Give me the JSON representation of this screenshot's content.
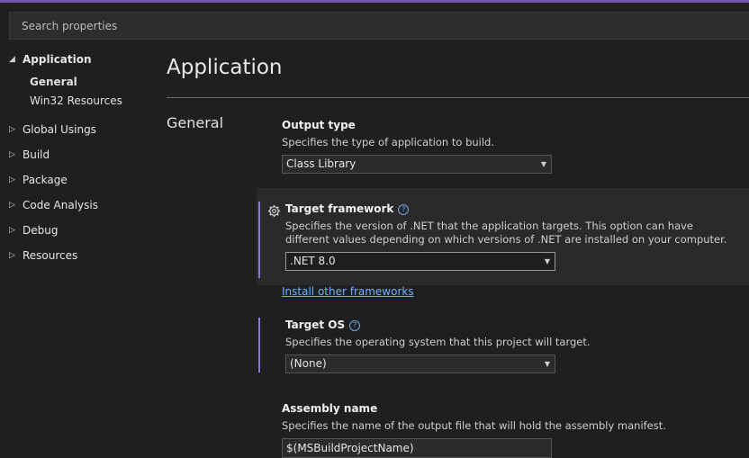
{
  "search": {
    "placeholder": "Search properties"
  },
  "sidebar": {
    "groups": [
      {
        "label": "Application",
        "expanded": true,
        "children": [
          "General",
          "Win32 Resources"
        ]
      },
      {
        "label": "Global Usings"
      },
      {
        "label": "Build"
      },
      {
        "label": "Package"
      },
      {
        "label": "Code Analysis"
      },
      {
        "label": "Debug"
      },
      {
        "label": "Resources"
      }
    ]
  },
  "main": {
    "title": "Application",
    "section": "General",
    "output_type": {
      "label": "Output type",
      "desc": "Specifies the type of application to build.",
      "value": "Class Library"
    },
    "target_framework": {
      "label": "Target framework",
      "desc": "Specifies the version of .NET that the application targets. This option can have different values depending on which versions of .NET are installed on your computer.",
      "value": ".NET 8.0",
      "link": "Install other frameworks"
    },
    "target_os": {
      "label": "Target OS",
      "desc": "Specifies the operating system that this project will target.",
      "value": "(None)"
    },
    "assembly_name": {
      "label": "Assembly name",
      "desc": "Specifies the name of the output file that will hold the assembly manifest.",
      "value": "$(MSBuildProjectName)"
    },
    "icons": {
      "help": "?"
    }
  },
  "colors": {
    "accent": "#8a75d6",
    "link": "#6cb2ff",
    "top_accent": "#6e58a8"
  }
}
